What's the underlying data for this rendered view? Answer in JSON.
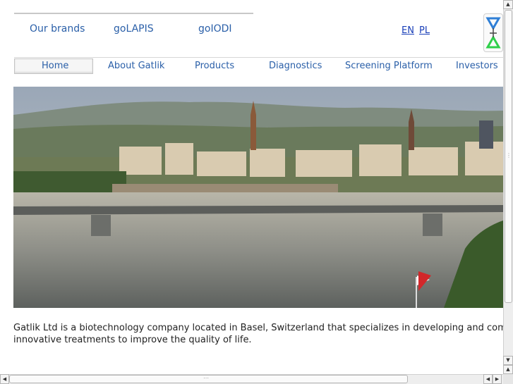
{
  "brands": [
    "Our brands",
    "goLAPIS",
    "goIODI"
  ],
  "languages": [
    "EN",
    "PL"
  ],
  "nav": [
    "Home",
    "About Gatlik",
    "Products",
    "Diagnostics",
    "Screening Platform",
    "Investors"
  ],
  "intro": {
    "line1": "Gatlik Ltd is a biotechnology company located in Basel, Switzerland that specializes in developing and commerci",
    "line2": "innovative treatments to improve the quality of life."
  },
  "logo": {
    "icon": "hourglass-logo-icon",
    "top_color": "#2f7fd6",
    "bottom_color": "#2fcf4a"
  },
  "hero": {
    "icon": "basel-rhine-panorama-photo"
  },
  "scrollbars": {
    "up": "▲",
    "down": "▼",
    "left": "◀",
    "right": "▶"
  }
}
